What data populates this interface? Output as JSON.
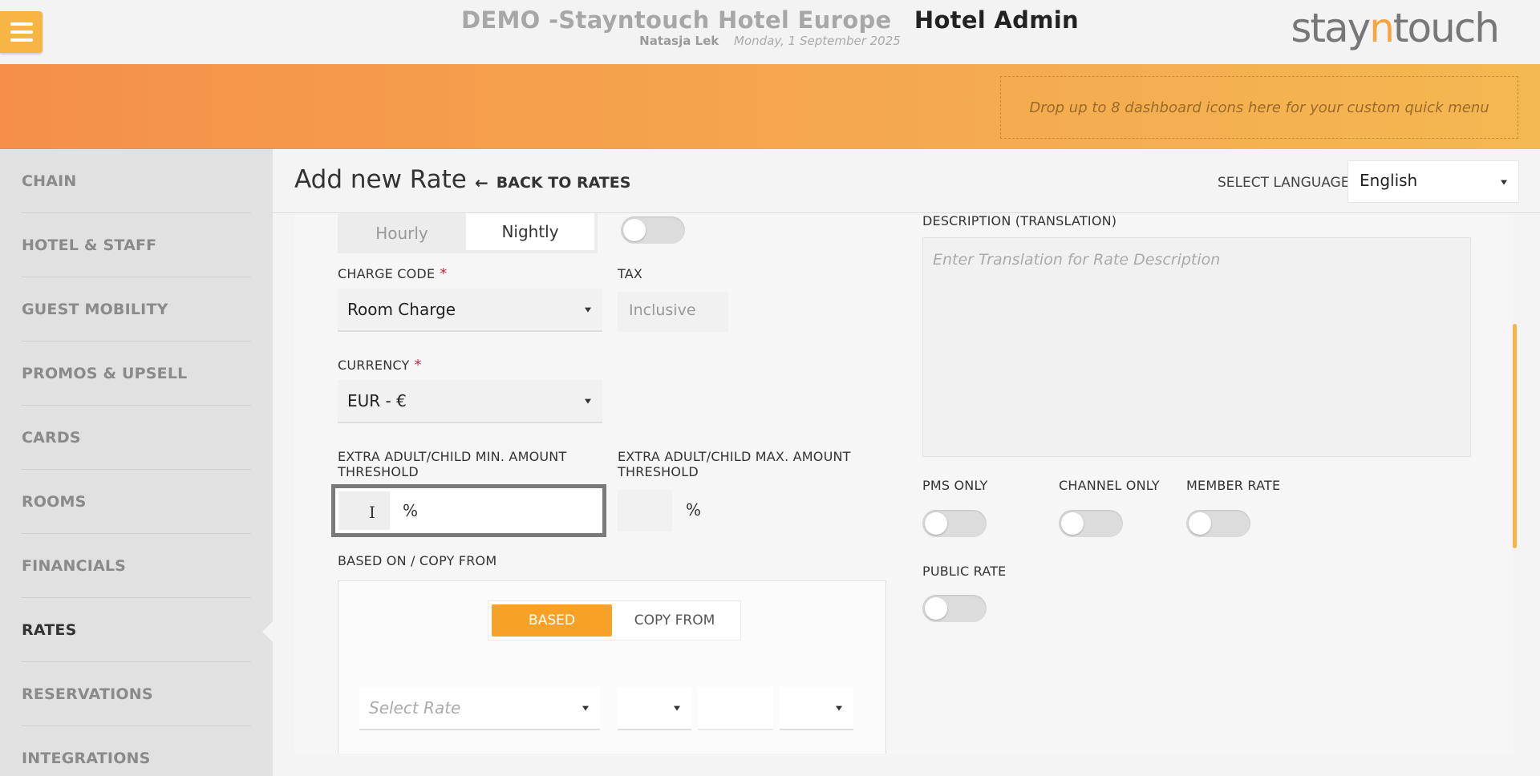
{
  "header": {
    "hotel_name": "DEMO -Stayntouch Hotel Europe",
    "app_name": "Hotel Admin",
    "user": "Natasja Lek",
    "date": "Monday, 1 September 2025",
    "brand_pre": "stay",
    "brand_n": "n",
    "brand_post": "touch",
    "quick_menu_hint": "Drop up to 8 dashboard icons here for your custom quick menu"
  },
  "sidebar": {
    "items": [
      {
        "label": "CHAIN"
      },
      {
        "label": "HOTEL & STAFF"
      },
      {
        "label": "GUEST MOBILITY"
      },
      {
        "label": "PROMOS & UPSELL"
      },
      {
        "label": "CARDS"
      },
      {
        "label": "ROOMS"
      },
      {
        "label": "FINANCIALS"
      },
      {
        "label": "RATES",
        "active": true
      },
      {
        "label": "RESERVATIONS"
      },
      {
        "label": "INTEGRATIONS"
      }
    ]
  },
  "page": {
    "title": "Add new Rate",
    "back_label": "BACK TO RATES",
    "language_label": "SELECT LANGUAGE",
    "language_value": "English"
  },
  "form": {
    "rate_period": {
      "options": [
        "Hourly",
        "Nightly"
      ],
      "selected": "Nightly"
    },
    "charge_code_label": "CHARGE CODE",
    "charge_code_value": "Room Charge",
    "required_mark": "*",
    "tax_label": "TAX",
    "tax_value": "Inclusive",
    "currency_label": "CURRENCY",
    "currency_value": "EUR - €",
    "min_threshold_label": "EXTRA ADULT/CHILD MIN. AMOUNT THRESHOLD",
    "max_threshold_label": "EXTRA ADULT/CHILD MAX. AMOUNT THRESHOLD",
    "percent": "%",
    "cursor_glyph": "I",
    "based_on_label": "BASED ON / COPY FROM",
    "based_tab": "BASED",
    "copy_tab": "COPY FROM",
    "select_rate_placeholder": "Select Rate",
    "description_label": "DESCRIPTION (TRANSLATION)",
    "description_placeholder": "Enter Translation for Rate Description",
    "pms_only_label": "PMS ONLY",
    "channel_only_label": "CHANNEL ONLY",
    "member_rate_label": "MEMBER RATE",
    "public_rate_label": "PUBLIC RATE"
  },
  "colors": {
    "accent": "#f7a227",
    "band_start": "#f58f4a",
    "band_end": "#f4b852",
    "required": "#c0284a"
  }
}
